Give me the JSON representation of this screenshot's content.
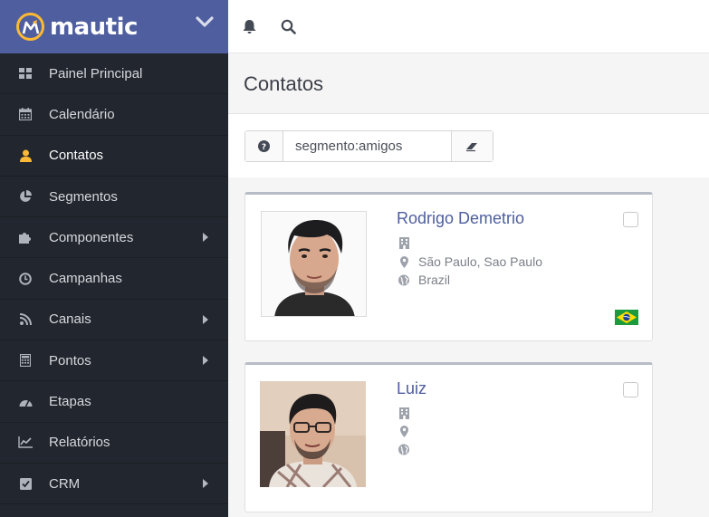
{
  "brand": {
    "name": "mautic"
  },
  "sidebar": {
    "items": [
      {
        "label": "Painel Principal",
        "icon": "dashboard-icon",
        "active": false,
        "has_submenu": false
      },
      {
        "label": "Calendário",
        "icon": "calendar-icon",
        "active": false,
        "has_submenu": false
      },
      {
        "label": "Contatos",
        "icon": "user-icon",
        "active": true,
        "has_submenu": false
      },
      {
        "label": "Segmentos",
        "icon": "pie-chart-icon",
        "active": false,
        "has_submenu": false
      },
      {
        "label": "Componentes",
        "icon": "puzzle-icon",
        "active": false,
        "has_submenu": true
      },
      {
        "label": "Campanhas",
        "icon": "clock-icon",
        "active": false,
        "has_submenu": false
      },
      {
        "label": "Canais",
        "icon": "rss-icon",
        "active": false,
        "has_submenu": true
      },
      {
        "label": "Pontos",
        "icon": "calculator-icon",
        "active": false,
        "has_submenu": true
      },
      {
        "label": "Etapas",
        "icon": "tachometer-icon",
        "active": false,
        "has_submenu": false
      },
      {
        "label": "Relatórios",
        "icon": "line-chart-icon",
        "active": false,
        "has_submenu": false
      },
      {
        "label": "CRM",
        "icon": "checkbox-icon",
        "active": false,
        "has_submenu": true
      }
    ]
  },
  "topbar": {
    "icons": [
      "bell-icon",
      "search-icon"
    ]
  },
  "page": {
    "title": "Contatos"
  },
  "search": {
    "value": "segmento:amigos",
    "placeholder": ""
  },
  "contacts": [
    {
      "name": "Rodrigo Demetrio",
      "company": "",
      "location": "São Paulo, Sao Paulo",
      "country": "Brazil",
      "flag": "brazil-flag"
    },
    {
      "name": "Luiz",
      "company": "",
      "location": "",
      "country": "",
      "flag": ""
    }
  ],
  "colors": {
    "sidebar_bg": "#22262e",
    "brand_bg": "#4e5e9e",
    "accent_orange": "#fdb933",
    "link_blue": "#4e5e9e",
    "nav_text": "#d6d8dd"
  }
}
